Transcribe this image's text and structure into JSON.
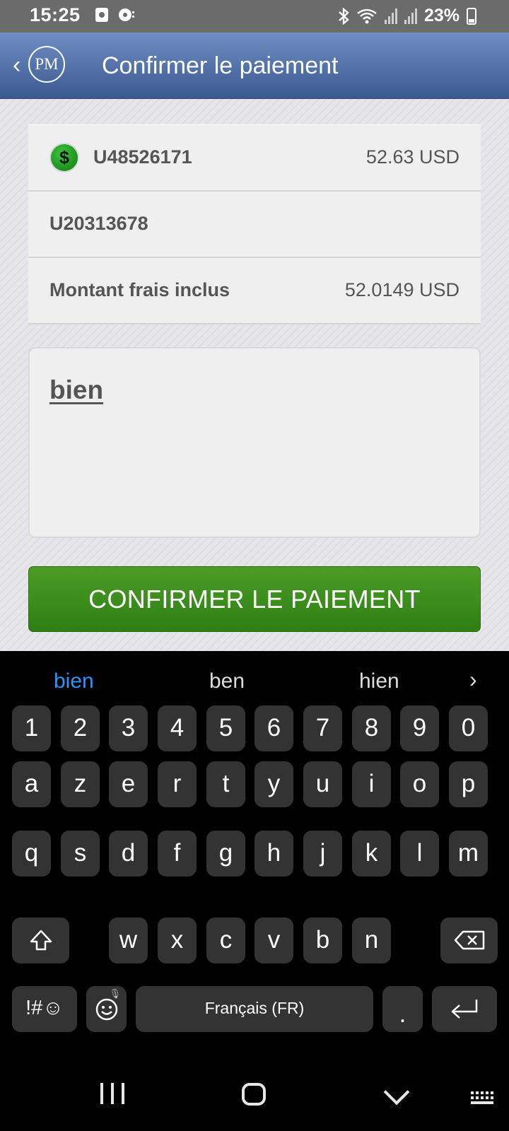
{
  "status_bar": {
    "time": "15:25",
    "battery": "23%",
    "icons": [
      "photo-icon",
      "media-icon",
      "bluetooth-icon",
      "wifi-icon",
      "signal-icon",
      "signal-icon",
      "battery-icon"
    ]
  },
  "header": {
    "logo_text": "PM",
    "title": "Confirmer le paiement"
  },
  "payment": {
    "from_account": "U48526171",
    "from_amount": "52.63 USD",
    "to_account": "U20313678",
    "fee_label": "Montant frais inclus",
    "fee_amount": "52.0149 USD"
  },
  "memo": {
    "value": "bien"
  },
  "confirm_button": {
    "label": "CONFIRMER LE PAIEMENT"
  },
  "keyboard": {
    "suggestions": [
      "bien",
      "ben",
      "hien"
    ],
    "numbers": [
      "1",
      "2",
      "3",
      "4",
      "5",
      "6",
      "7",
      "8",
      "9",
      "0"
    ],
    "row1": [
      "a",
      "z",
      "e",
      "r",
      "t",
      "y",
      "u",
      "i",
      "o",
      "p"
    ],
    "row2": [
      "q",
      "s",
      "d",
      "f",
      "g",
      "h",
      "j",
      "k",
      "l",
      "m"
    ],
    "row3": [
      "w",
      "x",
      "c",
      "v",
      "b",
      "n"
    ],
    "symbols_label": "!#☺",
    "space_label": "Français (FR)",
    "period_label": "."
  },
  "colors": {
    "header_top": "#6f8ec3",
    "header_bottom": "#3a5a92",
    "confirm_green": "#3c8e1c",
    "suggestion_active": "#2f93f0"
  }
}
